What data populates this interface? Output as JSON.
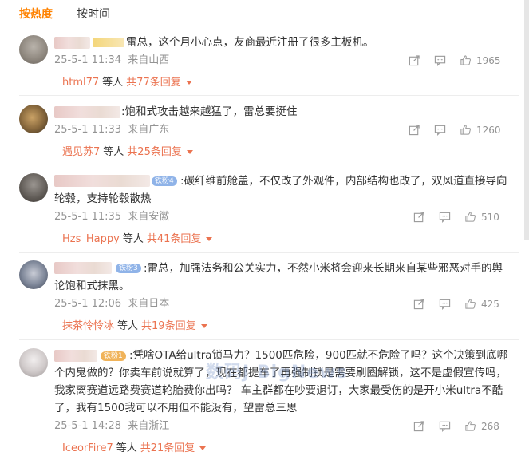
{
  "tabs": {
    "hot": "按热度",
    "time": "按时间"
  },
  "watermark": "数码J BigNews",
  "comments": [
    {
      "text": "雷总，这个月小心点，友商最近注册了很多主板机。",
      "time": "25-5-1 11:34",
      "location": "来自山西",
      "likes": "1965",
      "reply_user": "html77",
      "reply_deng": "等人",
      "reply_total": "共77条回复"
    },
    {
      "text": ":饱和式攻击越来越猛了，雷总要挺住",
      "time": "25-5-1 11:33",
      "location": "来自广东",
      "likes": "1260",
      "reply_user": "遇见苏7",
      "reply_deng": "等人",
      "reply_total": "共25条回复"
    },
    {
      "badge": "铁粉4",
      "text_line1": ":碳纤维前舱盖，不仅改了外观件，内部结构也改了，双风道直接导向",
      "text_line2": "轮毂，支持轮毂散热",
      "time": "25-5-1 11:35",
      "location": "来自安徽",
      "likes": "510",
      "reply_user": "Hzs_Happy",
      "reply_deng": "等人",
      "reply_total": "共41条回复"
    },
    {
      "badge": "铁粉3",
      "text_line1": ":雷总，加强法务和公关实力，不然小米将会迎来长期来自某些邪恶对手的舆",
      "text_line2": "论饱和式抹黑。",
      "time": "25-5-1 12:06",
      "location": "来自日本",
      "likes": "425",
      "reply_user": "抹茶怜怜冰",
      "reply_deng": "等人",
      "reply_total": "共19条回复"
    },
    {
      "badge": "铁粉1",
      "text_line1": ":凭啥OTA给ultra锁马力？1500匹危险，900匹就不危险了吗？这个决策到底哪",
      "text_line2": "个内鬼做的？你卖车前说就算了，现在都提车了再强制锁是需要刷圈解锁，这不是虚假宣传吗，",
      "text_line3": "我家离赛道远路费赛道轮胎费你出吗？ 车主群都在吵要退订，大家最受伤的是开小米ultra不酷",
      "text_line4": "了，我有1500我可以不用但不能没有，望雷总三思",
      "time": "25-5-1 14:28",
      "location": "来自浙江",
      "likes": "268",
      "reply_user": "IceorFire7",
      "reply_deng": "等人",
      "reply_total": "共21条回复"
    }
  ]
}
